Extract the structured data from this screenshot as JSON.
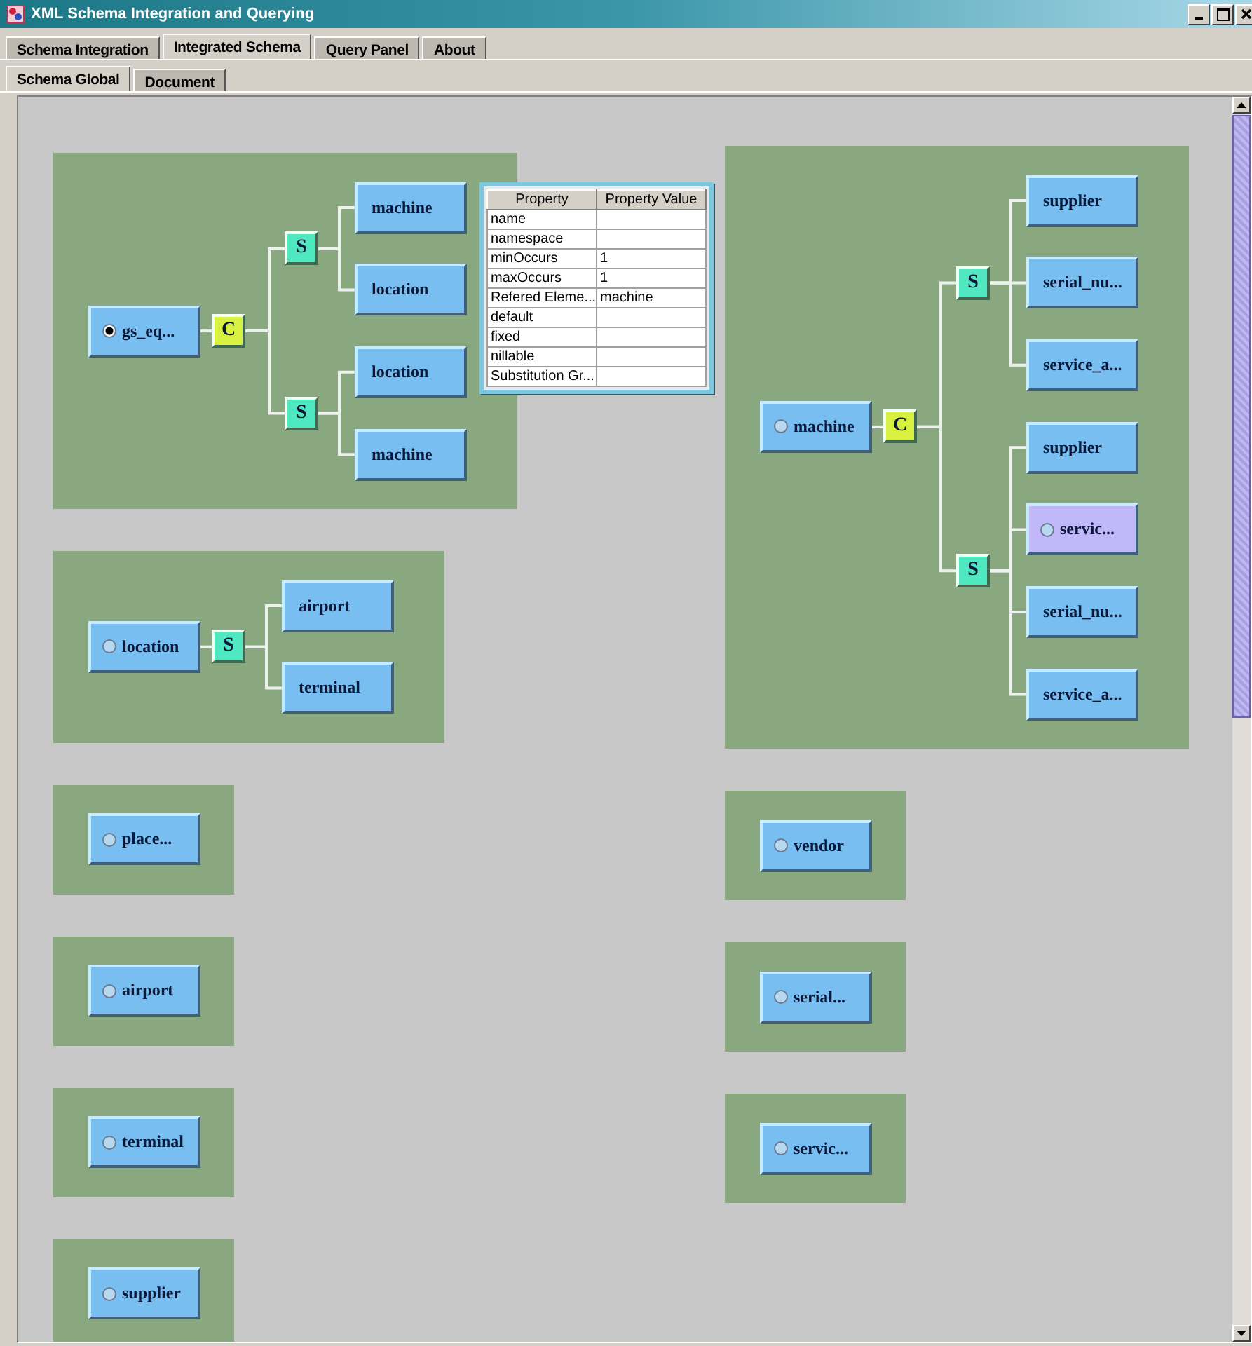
{
  "window": {
    "title": "XML Schema Integration and Querying"
  },
  "tabs": [
    {
      "label": "Schema Integration",
      "selected": false
    },
    {
      "label": "Integrated Schema",
      "selected": true
    },
    {
      "label": "Query Panel",
      "selected": false
    },
    {
      "label": "About",
      "selected": false
    }
  ],
  "subtabs": [
    {
      "label": "Schema Global",
      "selected": true
    },
    {
      "label": "Document",
      "selected": false
    }
  ],
  "columns": [
    {
      "panels": [
        {
          "root": {
            "kind": "element",
            "label": "gs_eq...",
            "radio": true,
            "selected": true,
            "group": {
              "kind": "choice",
              "label": "C",
              "children": [
                {
                  "kind": "sequence",
                  "label": "S",
                  "children": [
                    {
                      "kind": "element",
                      "label": "machine"
                    },
                    {
                      "kind": "element",
                      "label": "location"
                    }
                  ]
                },
                {
                  "kind": "sequence",
                  "label": "S",
                  "children": [
                    {
                      "kind": "element",
                      "label": "location"
                    },
                    {
                      "kind": "element",
                      "label": "machine"
                    }
                  ]
                }
              ]
            }
          },
          "property_table": {
            "columns": [
              "Property",
              "Property Value"
            ],
            "rows": [
              {
                "property": "name"
              },
              {
                "property": "namespace"
              },
              {
                "property": "minOccurs",
                "value": "1"
              },
              {
                "property": "maxOccurs",
                "value": "1"
              },
              {
                "property": "Refered Eleme...",
                "value": "machine"
              },
              {
                "property": "default"
              },
              {
                "property": "fixed"
              },
              {
                "property": "nillable"
              },
              {
                "property": "Substitution Gr..."
              }
            ]
          }
        },
        {
          "root": {
            "kind": "element",
            "label": "location",
            "radio": true,
            "selected": false,
            "group": {
              "kind": "sequence",
              "label": "S",
              "children": [
                {
                  "kind": "element",
                  "label": "airport"
                },
                {
                  "kind": "element",
                  "label": "terminal"
                }
              ]
            }
          }
        },
        {
          "root": {
            "kind": "element",
            "label": "place...",
            "radio": true,
            "selected": false
          }
        },
        {
          "root": {
            "kind": "element",
            "label": "airport",
            "radio": true,
            "selected": false
          }
        },
        {
          "root": {
            "kind": "element",
            "label": "terminal",
            "radio": true,
            "selected": false
          }
        },
        {
          "root": {
            "kind": "element",
            "label": "supplier",
            "radio": true,
            "selected": false
          }
        }
      ]
    },
    {
      "panels": [
        {
          "root": {
            "kind": "element",
            "label": "machine",
            "radio": true,
            "selected": false,
            "group": {
              "kind": "choice",
              "label": "C",
              "children": [
                {
                  "kind": "sequence",
                  "label": "S",
                  "children": [
                    {
                      "kind": "element",
                      "label": "supplier"
                    },
                    {
                      "kind": "element",
                      "label": "serial_nu..."
                    },
                    {
                      "kind": "element",
                      "label": "service_a..."
                    }
                  ]
                },
                {
                  "kind": "sequence",
                  "label": "S",
                  "children": [
                    {
                      "kind": "element",
                      "label": "supplier"
                    },
                    {
                      "kind": "element",
                      "label": "servic...",
                      "radio": true,
                      "selected": false,
                      "highlighted": true
                    },
                    {
                      "kind": "element",
                      "label": "serial_nu..."
                    },
                    {
                      "kind": "element",
                      "label": "service_a..."
                    }
                  ]
                }
              ]
            }
          }
        },
        {
          "root": {
            "kind": "element",
            "label": "vendor",
            "radio": true,
            "selected": false
          }
        },
        {
          "root": {
            "kind": "element",
            "label": "serial...",
            "radio": true,
            "selected": false
          }
        },
        {
          "root": {
            "kind": "element",
            "label": "servic...",
            "radio": true,
            "selected": false
          }
        }
      ]
    }
  ]
}
